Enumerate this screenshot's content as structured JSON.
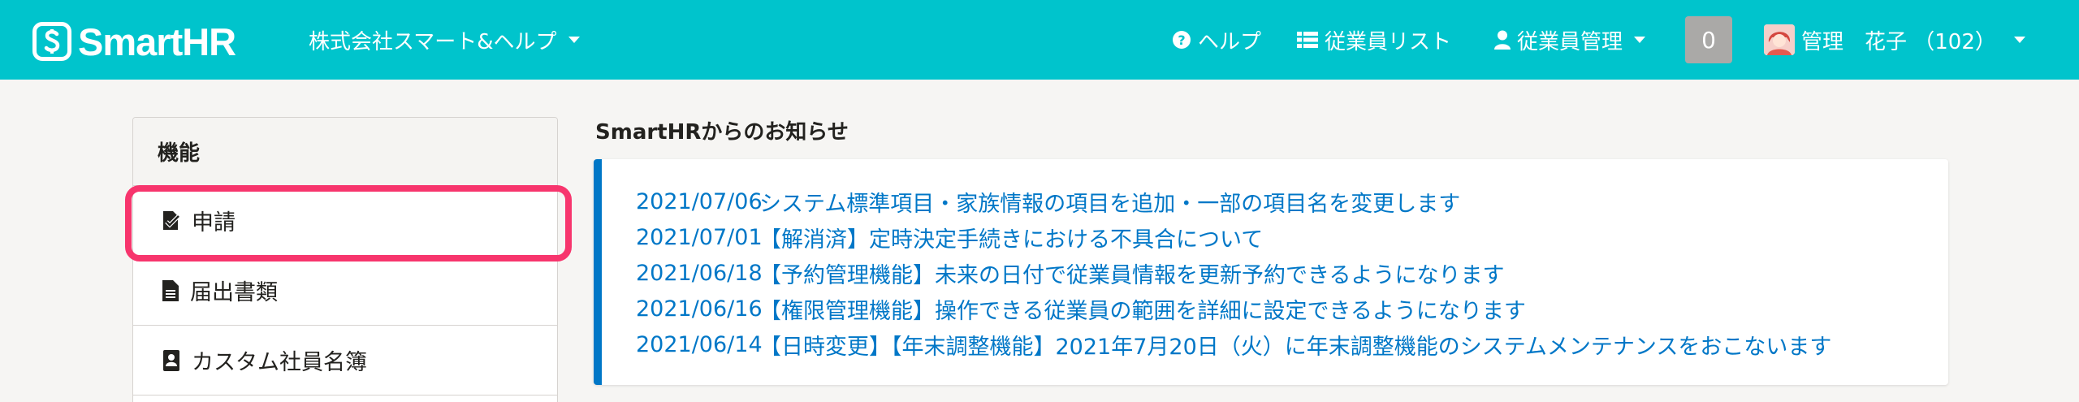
{
  "header": {
    "logo_text": "SmartHR",
    "company_name": "株式会社スマート&ヘルプ",
    "nav": {
      "help": "ヘルプ",
      "employee_list": "従業員リスト",
      "employee_mgmt": "従業員管理"
    },
    "notification_count": "0",
    "user_name": "管理　花子 （102）"
  },
  "sidebar": {
    "title": "機能",
    "items": [
      {
        "label": "申請",
        "icon": "check-document-icon"
      },
      {
        "label": "届出書類",
        "icon": "document-icon"
      },
      {
        "label": "カスタム社員名簿",
        "icon": "address-book-icon"
      }
    ]
  },
  "main": {
    "section_title": "SmartHRからのお知らせ",
    "notices": [
      {
        "date": "2021/07/06",
        "title": "システム標準項目・家族情報の項目を追加・一部の項目名を変更します"
      },
      {
        "date": "2021/07/01",
        "title": "【解消済】定時決定手続きにおける不具合について"
      },
      {
        "date": "2021/06/18",
        "title": "【予約管理機能】未来の日付で従業員情報を更新予約できるようになります"
      },
      {
        "date": "2021/06/16",
        "title": "【権限管理機能】操作できる従業員の範囲を詳細に設定できるようになります"
      },
      {
        "date": "2021/06/14",
        "title": "【日時変更】【年末調整機能】2021年7月20日（火）に年末調整機能のシステムメンテナンスをおこないます"
      }
    ]
  },
  "colors": {
    "header_bg": "#00c4cc",
    "link": "#0077c7",
    "highlight": "#f7356d"
  }
}
